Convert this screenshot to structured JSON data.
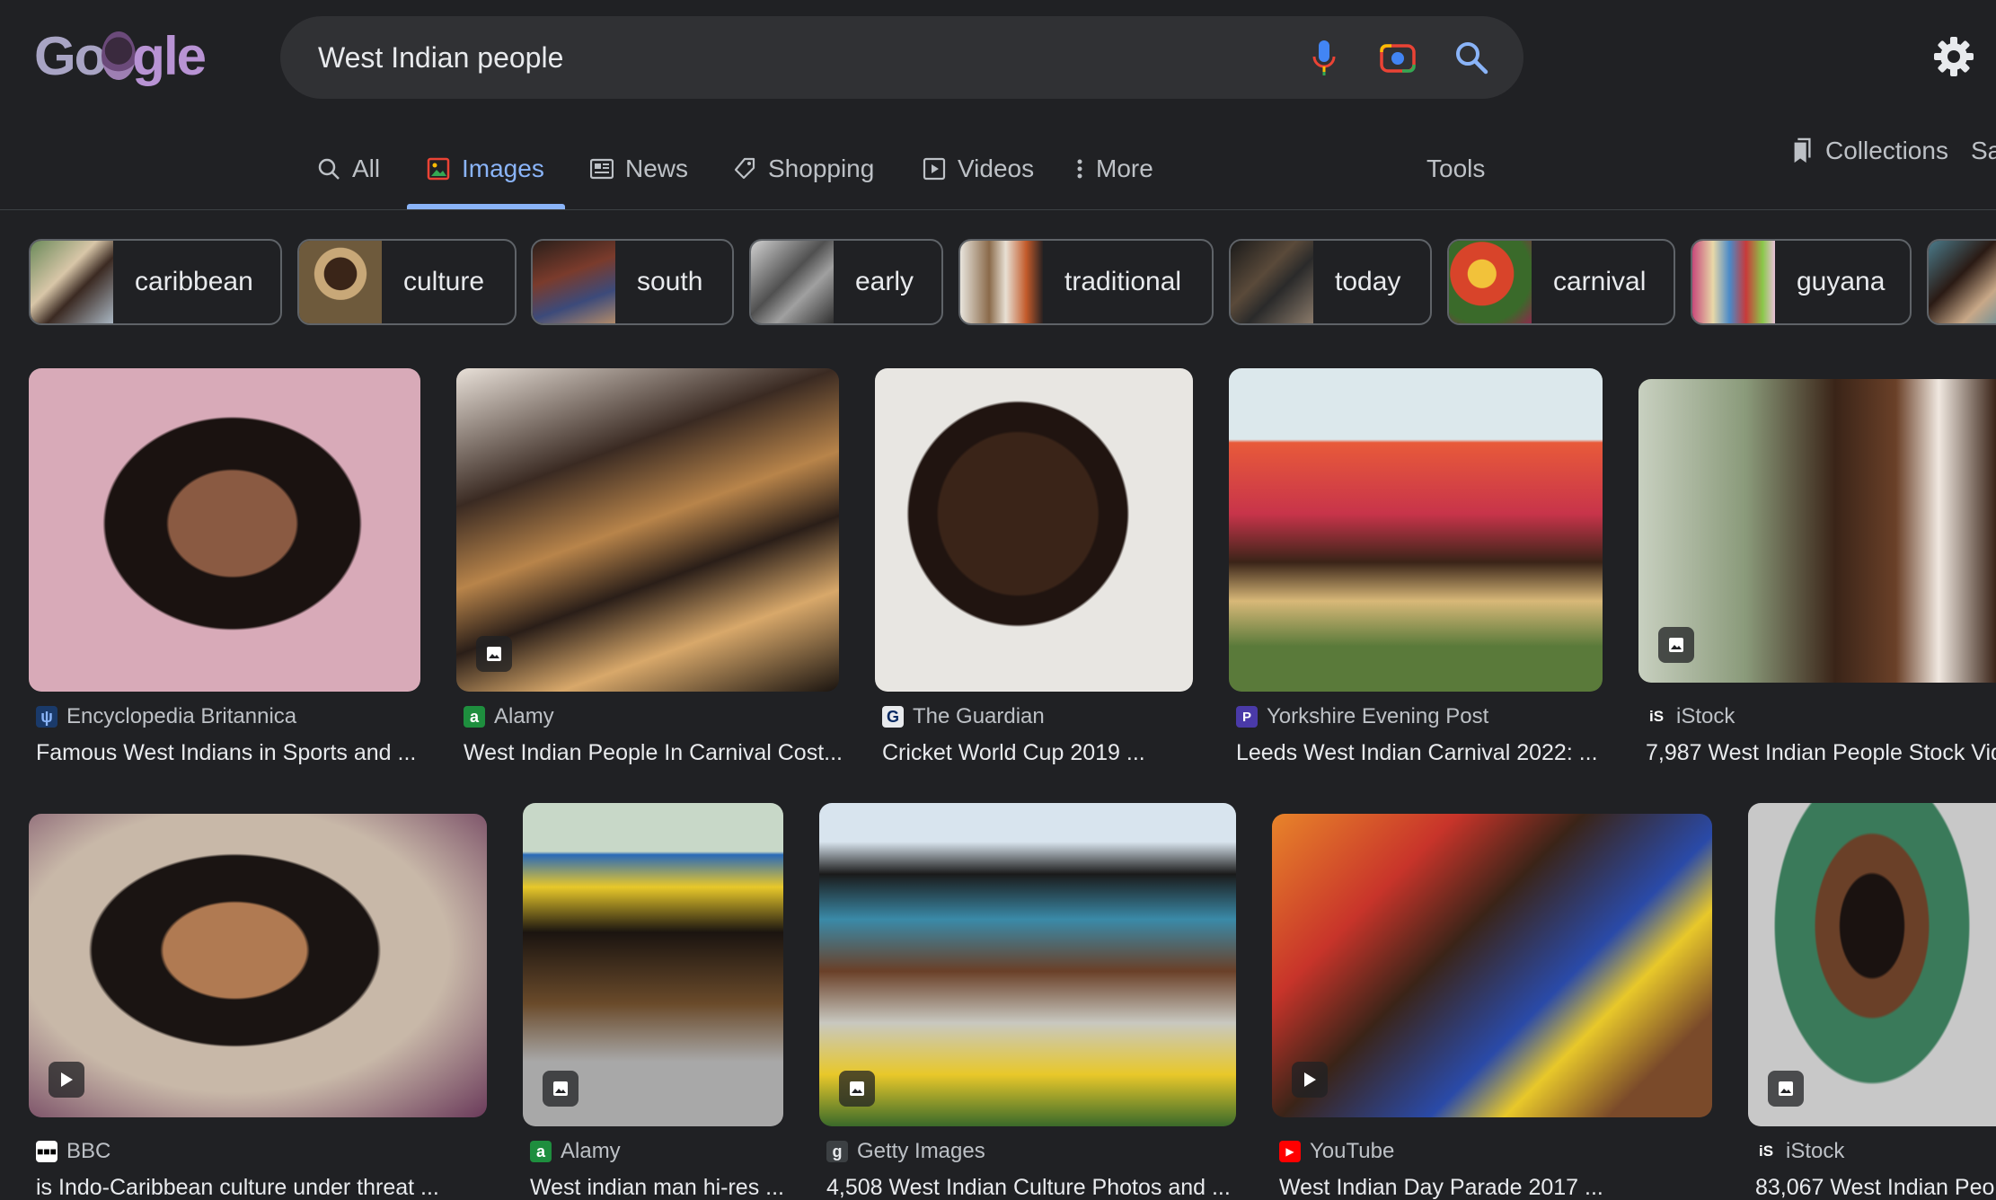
{
  "search": {
    "query": "West Indian people"
  },
  "tabs": {
    "all": "All",
    "images": "Images",
    "news": "News",
    "shopping": "Shopping",
    "videos": "Videos",
    "more": "More",
    "tools": "Tools",
    "collections": "Collections",
    "safesearch": "Sa"
  },
  "chips": [
    "caribbean",
    "culture",
    "south",
    "early",
    "traditional",
    "today",
    "carnival",
    "guyana"
  ],
  "results": [
    {
      "source": "Encyclopedia Britannica",
      "title": "Famous West Indians in Sports and ...",
      "badge": ""
    },
    {
      "source": "Alamy",
      "title": "West Indian People In Carnival Cost...",
      "badge": "image"
    },
    {
      "source": "The Guardian",
      "title": "Cricket World Cup 2019 ...",
      "badge": ""
    },
    {
      "source": "Yorkshire Evening Post",
      "title": "Leeds West Indian Carnival 2022: ...",
      "badge": ""
    },
    {
      "source": "iStock",
      "title": "7,987 West Indian People Stock Vid",
      "badge": "image"
    },
    {
      "source": "BBC",
      "title": "is Indo-Caribbean culture under threat ...",
      "badge": "play"
    },
    {
      "source": "Alamy",
      "title": "West indian man hi-res ...",
      "badge": "image"
    },
    {
      "source": "Getty Images",
      "title": "4,508 West Indian Culture Photos and ...",
      "badge": "image"
    },
    {
      "source": "YouTube",
      "title": "West Indian Day Parade 2017 ...",
      "badge": "play"
    },
    {
      "source": "iStock",
      "title": "83,067 West Indian Peop",
      "badge": "image"
    }
  ],
  "colors": {
    "accent": "#8ab4f8",
    "background": "#202124",
    "searchbar": "#303134"
  }
}
